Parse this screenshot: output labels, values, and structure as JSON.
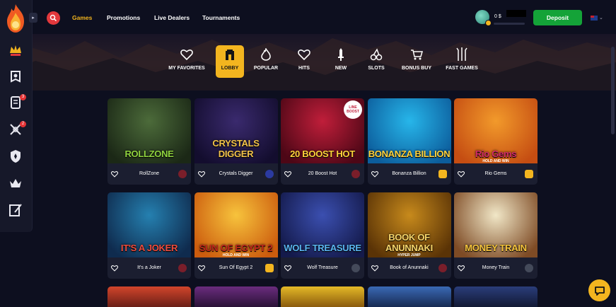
{
  "nav": {
    "items": [
      {
        "label": "Games",
        "active": true
      },
      {
        "label": "Promotions"
      },
      {
        "label": "Live Dealers"
      },
      {
        "label": "Tournaments"
      }
    ]
  },
  "account": {
    "balance": "0 $",
    "deposit_label": "Deposit"
  },
  "sidebar": {
    "items": [
      {
        "icon": "bonus-crown-icon"
      },
      {
        "icon": "shield-banner-icon"
      },
      {
        "icon": "scroll-icon",
        "badge": "3"
      },
      {
        "icon": "crossed-swords-icon",
        "badge": "2"
      },
      {
        "icon": "shield-icon"
      },
      {
        "icon": "crown-icon"
      },
      {
        "icon": "book-pen-icon"
      }
    ]
  },
  "categories": [
    {
      "label": "MY FAVORITES",
      "icon": "heart-icon"
    },
    {
      "label": "LOBBY",
      "icon": "lobby-icon",
      "active": true
    },
    {
      "label": "POPULAR",
      "icon": "flame-icon"
    },
    {
      "label": "HITS",
      "icon": "heart-icon"
    },
    {
      "label": "NEW",
      "icon": "sword-icon"
    },
    {
      "label": "SLOTS",
      "icon": "cherry-icon"
    },
    {
      "label": "BONUS BUY",
      "icon": "cart-icon"
    },
    {
      "label": "FAST GAMES",
      "icon": "spear-icon"
    }
  ],
  "games": [
    {
      "name": "RollZone",
      "art": "ROLLZONE",
      "colors": [
        "#4c6b3a",
        "#1b2816"
      ],
      "title_color": "#8fd23e"
    },
    {
      "name": "Crystals Digger",
      "art": "CRYSTALS DIGGER",
      "colors": [
        "#3a2a6e",
        "#130d2e"
      ],
      "title_color": "#f2c34a"
    },
    {
      "name": "20 Boost Hot",
      "art": "20 BOOST HOT",
      "colors": [
        "#c01e3a",
        "#4d0716"
      ],
      "title_color": "#ffd23a",
      "tag": "LINE BOOST"
    },
    {
      "name": "Bonanza Billion",
      "art": "BONANZA BILLION",
      "colors": [
        "#27b6ea",
        "#0c5d9c"
      ],
      "title_color": "#ffd33c"
    },
    {
      "name": "Rio Gems",
      "art": "Rio Gems",
      "colors": [
        "#f29a2b",
        "#c54d12"
      ],
      "title_color": "#d42b6b",
      "sub": "HOLD AND WIN"
    },
    {
      "name": "It's a Joker",
      "art": "IT'S A JOKER",
      "colors": [
        "#2580b0",
        "#0f2b4e"
      ],
      "title_color": "#f04b3c"
    },
    {
      "name": "Sun Of Egypt 2",
      "art": "SUN OF EGYPT 2",
      "colors": [
        "#f7c33c",
        "#cc5c0e"
      ],
      "title_color": "#c2281c",
      "sub": "HOLD AND WIN"
    },
    {
      "name": "Wolf Treasure",
      "art": "WOLF TREASURE",
      "colors": [
        "#3b4fb0",
        "#141a4b"
      ],
      "title_color": "#5ab6f0"
    },
    {
      "name": "Book of Anunnaki",
      "art": "BOOK OF ANUNNAKI",
      "colors": [
        "#c78a1c",
        "#5a3306"
      ],
      "title_color": "#f6d56a",
      "sub": "HYPER JUMP"
    },
    {
      "name": "Money Train",
      "art": "MONEY TRAIN",
      "colors": [
        "#f1e7c7",
        "#7e4b25"
      ],
      "title_color": "#f4c33b"
    }
  ],
  "colors": {
    "accent": "#f3b51f",
    "deposit": "#14a338",
    "search": "#e2383c"
  }
}
